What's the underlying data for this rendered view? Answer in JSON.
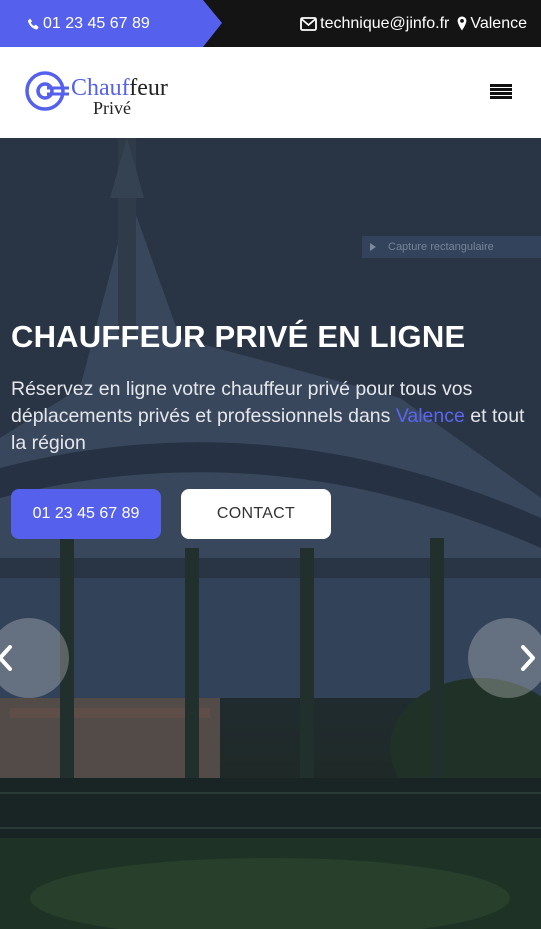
{
  "topbar": {
    "phone": "01 23 45 67 89",
    "email": "technique@jinfo.fr",
    "city": "Valence",
    "icons": [
      "phone-icon",
      "envelope-icon",
      "map-marker-icon"
    ],
    "accent": "#5561ec"
  },
  "header": {
    "logo_word1_a": "Chauf",
    "logo_word1_b": "feur",
    "logo_word2": "Privé",
    "menu_icon": "hamburger-icon"
  },
  "overlay_tooltip": "Capture rectangulaire",
  "hero": {
    "title": "CHAUFFEUR PRIVÉ EN LIGNE",
    "text_before": "Réservez en ligne votre chauffeur privé pour tous vos déplacements privés et professionnels dans ",
    "text_city": "Valence",
    "text_after": " et tout la région",
    "btn_phone": "01 23 45 67 89",
    "btn_contact": "CONTACT",
    "prev_icon": "chevron-left-icon",
    "next_icon": "chevron-right-icon"
  }
}
